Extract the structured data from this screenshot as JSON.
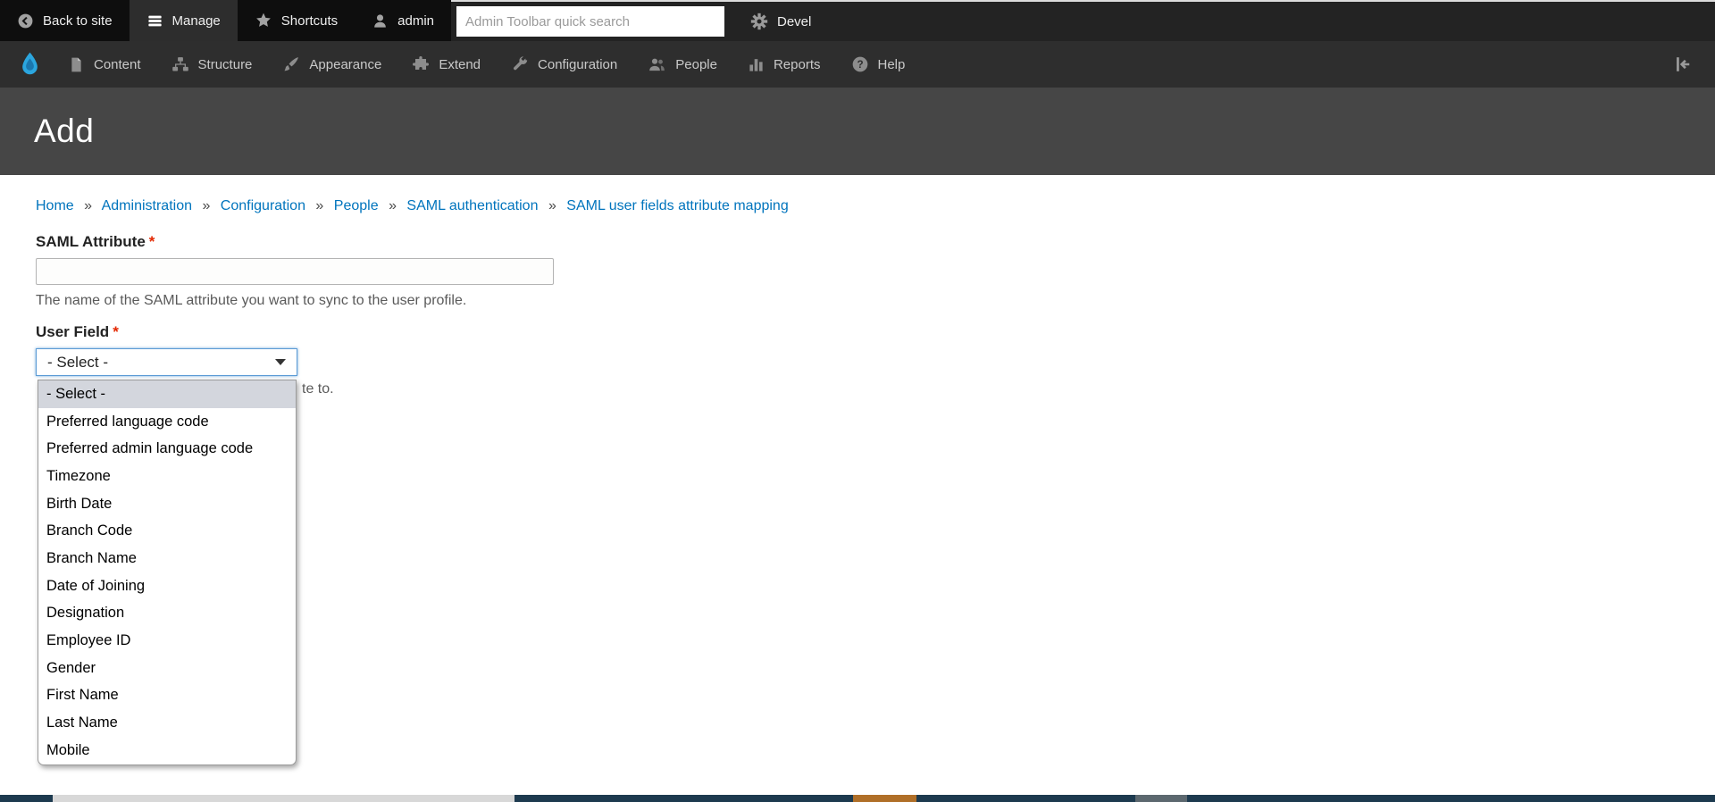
{
  "topbar": {
    "back_to_site": "Back to site",
    "manage": "Manage",
    "shortcuts": "Shortcuts",
    "user": "admin",
    "search_placeholder": "Admin Toolbar quick search",
    "devel": "Devel"
  },
  "admin_menu": {
    "items": [
      "Content",
      "Structure",
      "Appearance",
      "Extend",
      "Configuration",
      "People",
      "Reports",
      "Help"
    ]
  },
  "page": {
    "title": "Add"
  },
  "breadcrumb": {
    "separator": "»",
    "items": [
      "Home",
      "Administration",
      "Configuration",
      "People",
      "SAML authentication",
      "SAML user fields attribute mapping"
    ]
  },
  "form": {
    "saml_attribute": {
      "label": "SAML Attribute",
      "required": "*",
      "value": "",
      "description": "The name of the SAML attribute you want to sync to the user profile."
    },
    "user_field": {
      "label": "User Field",
      "required": "*",
      "selected": "- Select -",
      "description_visible": "te to.",
      "options": [
        "- Select -",
        "Preferred language code",
        "Preferred admin language code",
        "Timezone",
        "Birth Date",
        "Branch Code",
        "Branch Name",
        "Date of Joining",
        "Designation",
        "Employee ID",
        "Gender",
        "First Name",
        "Last Name",
        "Mobile"
      ]
    }
  },
  "colors": {
    "link_blue": "#0074bd",
    "drupal_logo_blue": "#2ba6df",
    "required_red": "#e32700",
    "select_focus_border": "#5b9bd5",
    "option_selected_bg": "#d3d6dd",
    "footer_navy": "#1d3a4f",
    "footer_orange": "#b06f28",
    "footer_gray": "#5c686f",
    "footer_light_gray": "#d8d8d8"
  }
}
